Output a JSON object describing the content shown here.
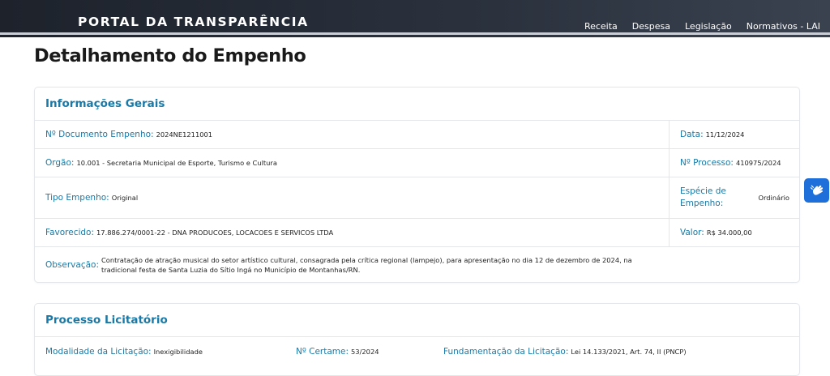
{
  "header": {
    "brand": "PORTAL DA TRANSPARÊNCIA",
    "nav": [
      "Receita",
      "Despesa",
      "Legislação",
      "Normativos - LAI"
    ]
  },
  "page_title": "Detalhamento do Empenho",
  "info": {
    "title": "Informações Gerais",
    "doc_label": "Nº Documento Empenho:",
    "doc_value": "2024NE1211001",
    "data_label": "Data:",
    "data_value": "11/12/2024",
    "orgao_label": "Orgão:",
    "orgao_value": "10.001 - Secretaria Municipal de Esporte, Turismo e Cultura",
    "processo_label": "Nº Processo:",
    "processo_value": "410975/2024",
    "tipo_label": "Tipo Empenho:",
    "tipo_value": "Original",
    "especie_label": "Espécie de Empenho:",
    "especie_value": "Ordinário",
    "favorecido_label": "Favorecido:",
    "favorecido_value": "17.886.274/0001-22 - DNA PRODUCOES, LOCACOES E SERVICOS LTDA",
    "valor_label": "Valor:",
    "valor_value": "R$ 34.000,00",
    "obs_label": "Observação:",
    "obs_value": "Contratação de atração musical do setor artístico cultural, consagrada pela crítica regional (lampejo), para apresentação no dia 12 de dezembro de 2024, na tradicional festa de Santa Luzia do Sítio Ingá no Município de Montanhas/RN."
  },
  "processo": {
    "title": "Processo Licitatório",
    "modalidade_label": "Modalidade da Licitação:",
    "modalidade_value": "Inexigibilidade",
    "certame_label": "Nº Certame:",
    "certame_value": "53/2024",
    "fund_label": "Fundamentação da Licitação:",
    "fund_value": "Lei 14.133/2021, Art. 74, II (PNCP)"
  },
  "accessibility": {
    "icon": "hand-sign-language-icon",
    "color": "#1e6fd9"
  },
  "colors": {
    "label": "#1a79a6",
    "header": "#1d222b"
  }
}
